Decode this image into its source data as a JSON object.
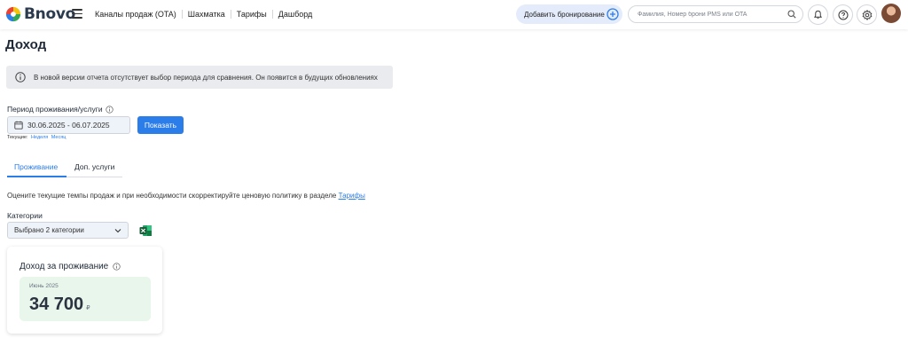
{
  "app": {
    "brand": "Bnovo"
  },
  "nav": [
    {
      "label": "Каналы продаж (OTA)"
    },
    {
      "label": "Шахматка"
    },
    {
      "label": "Тарифы"
    },
    {
      "label": "Дашборд"
    }
  ],
  "header": {
    "add_booking_label": "Добавить бронирование",
    "search_placeholder": "Фамилия, Номер брони PMS или OTA",
    "icons": [
      "bell-icon",
      "help-icon",
      "gear-icon"
    ]
  },
  "page": {
    "title": "Доход",
    "notice": "В новой версии отчета отсутствует выбор периода для сравнения. Он появится в будущих обновлениях"
  },
  "period": {
    "label": "Период проживания/услуги",
    "value": "30.06.2025 - 06.07.2025",
    "show_button": "Показать",
    "current_label": "Текущие:",
    "quick_week": "Неделя",
    "quick_month": "Месяц"
  },
  "tabs": [
    {
      "label": "Проживание",
      "active": true
    },
    {
      "label": "Доп. услуги",
      "active": false
    }
  ],
  "hint": {
    "text": "Оцените текущие темпы продаж и при необходимости скорректируйте ценовую политику в разделе",
    "link": "Тарифы"
  },
  "categories": {
    "label": "Категории",
    "selected": "Выбрано 2 категории"
  },
  "card": {
    "title": "Доход за проживание",
    "period": "Июнь 2025",
    "value": "34 700",
    "currency": "₽"
  },
  "colors": {
    "accent": "#2b7de9",
    "notice_bg": "#e9ebee",
    "metric_bg": "#e9f6ec",
    "excel_green": "#1d7044"
  }
}
